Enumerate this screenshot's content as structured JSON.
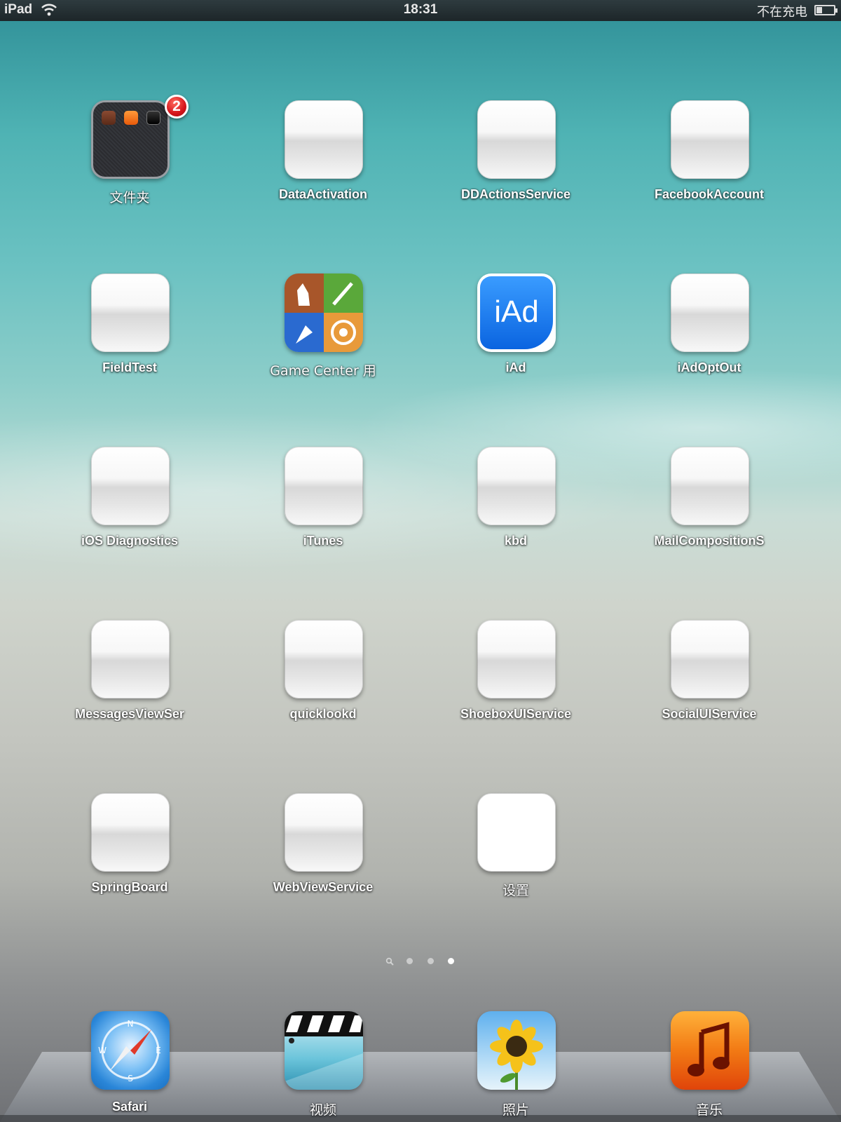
{
  "status_bar": {
    "carrier": "iPad",
    "time": "18:31",
    "charging": "不在充电",
    "battery_level": 0.35
  },
  "folder_badge": "2",
  "apps": [
    {
      "label": "文件夹",
      "type": "folder"
    },
    {
      "label": "DataActivation",
      "type": "blank"
    },
    {
      "label": "DDActionsService",
      "type": "blank"
    },
    {
      "label": "FacebookAccount",
      "type": "blank"
    },
    {
      "label": "FieldTest",
      "type": "blank"
    },
    {
      "label": "Game Center 用",
      "type": "gamecenter"
    },
    {
      "label": "iAd",
      "type": "iad",
      "icon_text": "iAd"
    },
    {
      "label": "iAdOptOut",
      "type": "blank"
    },
    {
      "label": "iOS Diagnostics",
      "type": "blank"
    },
    {
      "label": "iTunes",
      "type": "blank"
    },
    {
      "label": "kbd",
      "type": "blank"
    },
    {
      "label": "MailCompositionS",
      "type": "blank"
    },
    {
      "label": "MessagesViewSer",
      "type": "blank"
    },
    {
      "label": "quicklookd",
      "type": "blank"
    },
    {
      "label": "ShoeboxUIService",
      "type": "blank"
    },
    {
      "label": "SocialUIService",
      "type": "blank"
    },
    {
      "label": "SpringBoard",
      "type": "blank"
    },
    {
      "label": "WebViewService",
      "type": "blank"
    },
    {
      "label": "设置",
      "type": "white"
    }
  ],
  "dock": [
    {
      "label": "Safari",
      "icon": "safari-compass-icon"
    },
    {
      "label": "视频",
      "icon": "videos-clapperboard-icon"
    },
    {
      "label": "照片",
      "icon": "photos-sunflower-icon"
    },
    {
      "label": "音乐",
      "icon": "music-note-icon"
    }
  ],
  "page_indicator": {
    "pages": 4,
    "current": 4
  },
  "colors": {
    "badge": "#d4141b",
    "iad_blue": "#1a7ff0",
    "music_orange": "#f06a10"
  }
}
